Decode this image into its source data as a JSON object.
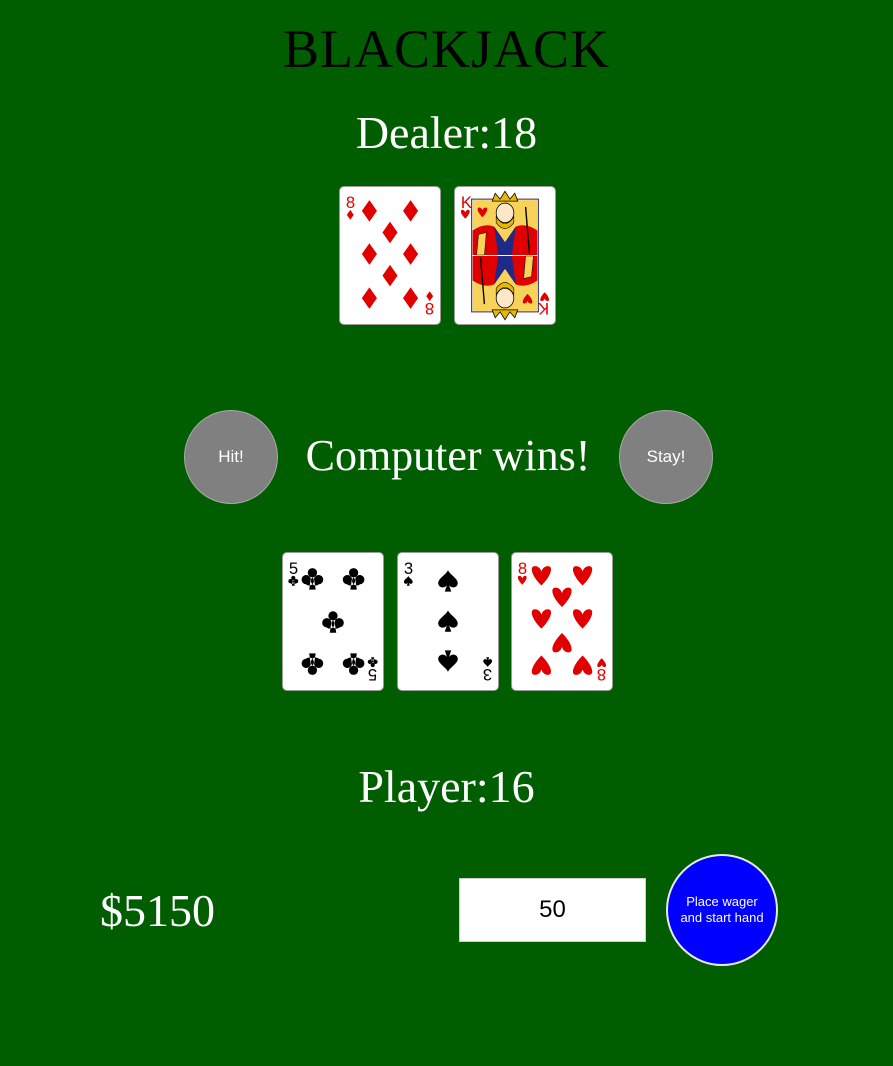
{
  "title": "BLACKJACK",
  "dealer": {
    "label": "Dealer:",
    "score": "18",
    "cards": [
      {
        "rank": "8",
        "suit": "diamonds"
      },
      {
        "rank": "K",
        "suit": "hearts"
      }
    ]
  },
  "controls": {
    "hit_label": "Hit!",
    "stay_label": "Stay!",
    "status": "Computer wins!"
  },
  "player": {
    "label": "Player:",
    "score": "16",
    "cards": [
      {
        "rank": "5",
        "suit": "clubs"
      },
      {
        "rank": "3",
        "suit": "spades"
      },
      {
        "rank": "8",
        "suit": "hearts"
      }
    ]
  },
  "bankroll": "$5150",
  "wager": {
    "value": "50",
    "button_label": "Place wager and start hand"
  },
  "colors": {
    "table": "#005e00",
    "red_suit": "#e00000",
    "black_suit": "#000000",
    "wager_button": "#0000ff",
    "action_button": "#808080"
  }
}
